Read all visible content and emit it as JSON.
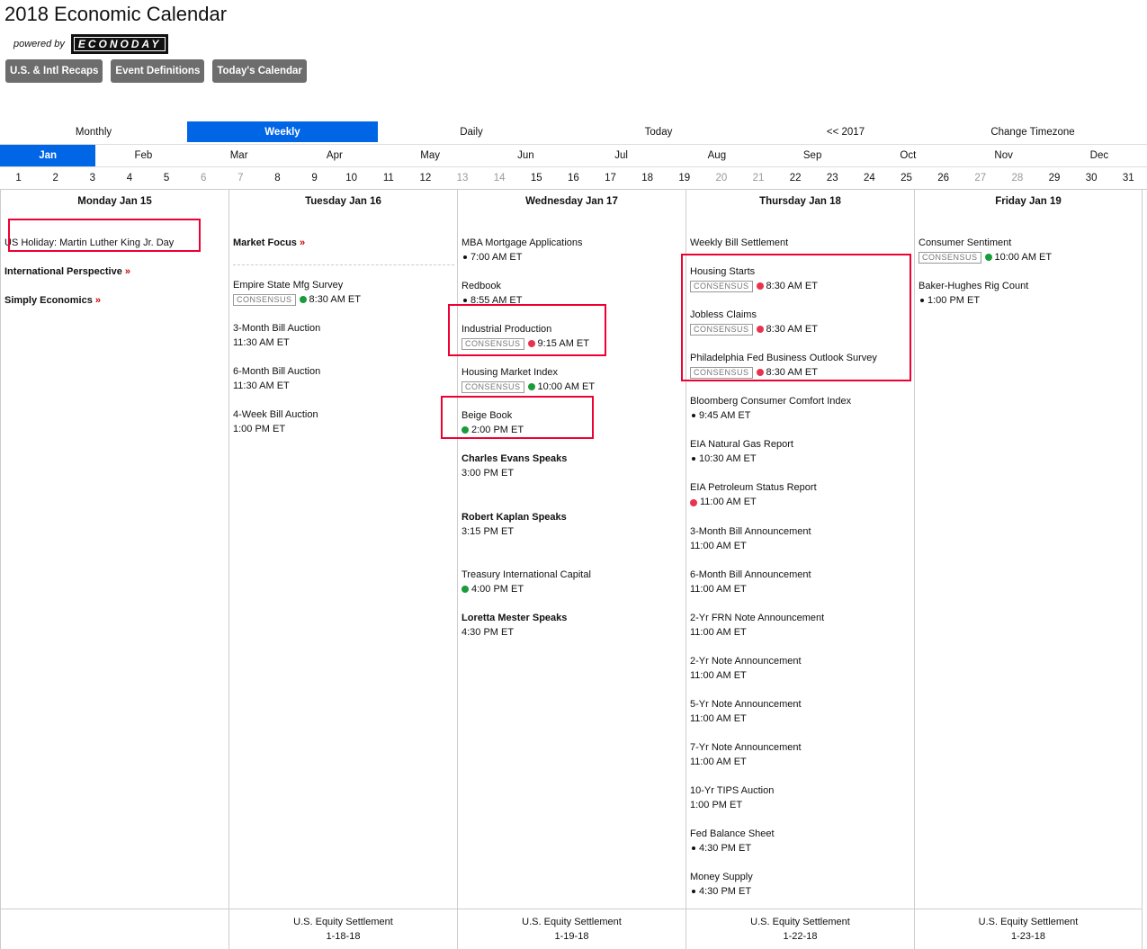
{
  "page": {
    "title": "2018 Economic Calendar",
    "powered_by": "powered by",
    "logo_text": "ECONODAY",
    "buttons": [
      "U.S. & Intl Recaps",
      "Event Definitions",
      "Today's Calendar"
    ]
  },
  "views": [
    {
      "label": "Monthly",
      "active": false
    },
    {
      "label": "Weekly",
      "active": true
    },
    {
      "label": "Daily",
      "active": false
    },
    {
      "label": "Today",
      "active": false
    },
    {
      "label": "<< 2017",
      "active": false
    },
    {
      "label": "Change Timezone",
      "active": false
    }
  ],
  "months": [
    {
      "label": "Jan",
      "active": true
    },
    {
      "label": "Feb"
    },
    {
      "label": "Mar"
    },
    {
      "label": "Apr"
    },
    {
      "label": "May"
    },
    {
      "label": "Jun"
    },
    {
      "label": "Jul"
    },
    {
      "label": "Aug"
    },
    {
      "label": "Sep"
    },
    {
      "label": "Oct"
    },
    {
      "label": "Nov"
    },
    {
      "label": "Dec"
    }
  ],
  "days": [
    {
      "d": "1"
    },
    {
      "d": "2"
    },
    {
      "d": "3"
    },
    {
      "d": "4"
    },
    {
      "d": "5"
    },
    {
      "d": "6",
      "we": true
    },
    {
      "d": "7",
      "we": true
    },
    {
      "d": "8"
    },
    {
      "d": "9"
    },
    {
      "d": "10"
    },
    {
      "d": "11"
    },
    {
      "d": "12"
    },
    {
      "d": "13",
      "we": true
    },
    {
      "d": "14",
      "we": true
    },
    {
      "d": "15"
    },
    {
      "d": "16"
    },
    {
      "d": "17"
    },
    {
      "d": "18"
    },
    {
      "d": "19"
    },
    {
      "d": "20",
      "we": true
    },
    {
      "d": "21",
      "we": true
    },
    {
      "d": "22"
    },
    {
      "d": "23"
    },
    {
      "d": "24"
    },
    {
      "d": "25"
    },
    {
      "d": "26"
    },
    {
      "d": "27",
      "we": true
    },
    {
      "d": "28",
      "we": true
    },
    {
      "d": "29"
    },
    {
      "d": "30"
    },
    {
      "d": "31"
    }
  ],
  "colors": {
    "red": "#e8334f",
    "green": "#1a9b3c",
    "black": "#111",
    "accent": "#0066e6"
  },
  "columns": [
    {
      "head": "Monday Jan 15",
      "events": [
        {
          "name": "US Holiday: Martin Luther King Jr. Day"
        },
        {
          "name": "International Perspective",
          "bold": true,
          "arrow": true
        },
        {
          "name": "Simply Economics",
          "bold": true,
          "arrow": true
        }
      ],
      "footer": []
    },
    {
      "head": "Tuesday Jan 16",
      "events": [
        {
          "name": "Market Focus",
          "bold": true,
          "arrow": true,
          "dash": true
        },
        {
          "name": "Empire State Mfg Survey",
          "consensus": true,
          "dot": "green",
          "time": "8:30 AM ET"
        },
        {
          "name": "3-Month Bill Auction",
          "time": "11:30 AM ET"
        },
        {
          "name": "6-Month Bill Auction",
          "time": "11:30 AM ET"
        },
        {
          "name": "4-Week Bill Auction",
          "time": "1:00 PM ET"
        }
      ],
      "footer": [
        "U.S. Equity Settlement",
        "1-18-18"
      ]
    },
    {
      "head": "Wednesday Jan 17",
      "events": [
        {
          "name": "MBA Mortgage Applications",
          "dot": "black",
          "time": "7:00 AM ET"
        },
        {
          "name": "Redbook",
          "dot": "black",
          "time": "8:55 AM ET"
        },
        {
          "name": "Industrial Production",
          "consensus": true,
          "dot": "red",
          "time": "9:15 AM ET"
        },
        {
          "name": "Housing Market Index",
          "consensus": true,
          "dot": "green",
          "time": "10:00 AM ET"
        },
        {
          "name": "Beige Book",
          "dot": "green",
          "time": "2:00 PM ET"
        },
        {
          "name": "Charles Evans Speaks",
          "bold": true,
          "time": "3:00 PM ET",
          "extra": true
        },
        {
          "name": "Robert Kaplan Speaks",
          "bold": true,
          "time": "3:15 PM ET",
          "extra": true
        },
        {
          "name": "Treasury International Capital",
          "dot": "green",
          "time": "4:00 PM ET"
        },
        {
          "name": "Loretta Mester Speaks",
          "bold": true,
          "time": "4:30 PM ET"
        }
      ],
      "footer": [
        "U.S. Equity Settlement",
        "1-19-18"
      ]
    },
    {
      "head": "Thursday Jan 18",
      "events": [
        {
          "name": "Weekly Bill Settlement"
        },
        {
          "name": "Housing Starts",
          "consensus": true,
          "dot": "red",
          "time": "8:30 AM ET"
        },
        {
          "name": "Jobless Claims",
          "consensus": true,
          "dot": "red",
          "time": "8:30 AM ET"
        },
        {
          "name": "Philadelphia Fed Business Outlook Survey",
          "consensus": true,
          "dot": "red",
          "time": "8:30 AM ET"
        },
        {
          "name": "Bloomberg Consumer Comfort Index",
          "dot": "black",
          "time": "9:45 AM ET"
        },
        {
          "name": "EIA Natural Gas Report",
          "dot": "black",
          "time": "10:30 AM ET"
        },
        {
          "name": "EIA Petroleum Status Report",
          "dot": "red",
          "time": "11:00 AM ET"
        },
        {
          "name": "3-Month Bill Announcement",
          "time": "11:00 AM ET"
        },
        {
          "name": "6-Month Bill Announcement",
          "time": "11:00 AM ET"
        },
        {
          "name": "2-Yr FRN Note Announcement",
          "time": "11:00 AM ET"
        },
        {
          "name": "2-Yr Note Announcement",
          "time": "11:00 AM ET"
        },
        {
          "name": "5-Yr Note Announcement",
          "time": "11:00 AM ET"
        },
        {
          "name": "7-Yr Note Announcement",
          "time": "11:00 AM ET"
        },
        {
          "name": "10-Yr TIPS Auction",
          "time": "1:00 PM ET"
        },
        {
          "name": "Fed Balance Sheet",
          "dot": "black",
          "time": "4:30 PM ET"
        },
        {
          "name": "Money Supply",
          "dot": "black",
          "time": "4:30 PM ET"
        }
      ],
      "footer": [
        "U.S. Equity Settlement",
        "1-22-18"
      ]
    },
    {
      "head": "Friday Jan 19",
      "events": [
        {
          "name": "Consumer Sentiment",
          "consensus": true,
          "dot": "green",
          "time": "10:00 AM ET"
        },
        {
          "name": "Baker-Hughes Rig Count",
          "dot": "black",
          "time": "1:00 PM ET"
        }
      ],
      "footer": [
        "U.S. Equity Settlement",
        "1-23-18"
      ]
    }
  ],
  "labels": {
    "consensus": "CONSENSUS",
    "arrow": "»"
  }
}
